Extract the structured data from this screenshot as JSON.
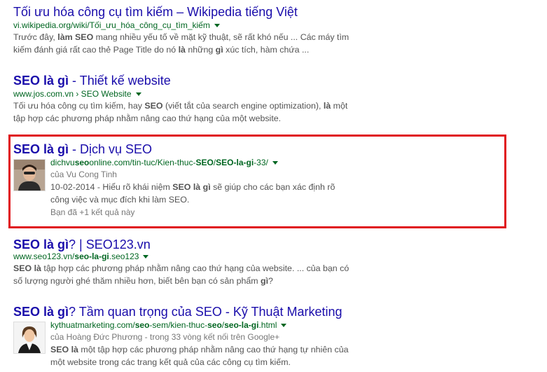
{
  "results": [
    {
      "title": "Tối ưu hóa công cụ tìm kiếm – Wikipedia tiếng Việt",
      "url": "vi.wikipedia.org/wiki/Tối_ưu_hóa_công_cụ_tìm_kiếm",
      "snippet_lines": [
        [
          {
            "t": "Trước đây, ",
            "b": false
          },
          {
            "t": "làm SEO",
            "b": true
          },
          {
            "t": " mang nhiều yếu tố về mặt kỹ thuật, sẽ rất khó nếu ... Các máy tìm",
            "b": false
          }
        ],
        [
          {
            "t": "kiếm đánh giá rất cao thẻ Page Title do nó ",
            "b": false
          },
          {
            "t": "là",
            "b": true
          },
          {
            "t": " những ",
            "b": false
          },
          {
            "t": "gì",
            "b": true
          },
          {
            "t": " xúc tích, hàm chứa ...",
            "b": false
          }
        ]
      ]
    },
    {
      "title_parts": [
        {
          "t": "SEO là gì",
          "b": true
        },
        {
          "t": " - Thiết kế website",
          "b": false
        }
      ],
      "url_parts": [
        {
          "t": "www.jos.com.vn › SEO Website",
          "b": false
        }
      ],
      "snippet_lines": [
        [
          {
            "t": "Tối ưu hóa công cụ tìm kiếm, hay ",
            "b": false
          },
          {
            "t": "SEO",
            "b": true
          },
          {
            "t": " (viết tắt của search engine optimization), ",
            "b": false
          },
          {
            "t": "là",
            "b": true
          },
          {
            "t": " một",
            "b": false
          }
        ],
        [
          {
            "t": "tập hợp các phương pháp nhằm nâng cao thứ hạng của một website.",
            "b": false
          }
        ]
      ]
    },
    {
      "title_parts": [
        {
          "t": "SEO là gì",
          "b": true
        },
        {
          "t": " - Dịch vụ SEO",
          "b": false
        }
      ],
      "url_parts": [
        {
          "t": "dichvu",
          "b": false
        },
        {
          "t": "seo",
          "b": true
        },
        {
          "t": "online.com/tin-tuc/Kien-thuc-",
          "b": false
        },
        {
          "t": "SEO",
          "b": true
        },
        {
          "t": "/",
          "b": false
        },
        {
          "t": "SEO-la-gi",
          "b": true
        },
        {
          "t": "-33/",
          "b": false
        }
      ],
      "author": "của Vu Cong Tinh",
      "snippet_lines": [
        [
          {
            "t": "10-02-2014 - Hiểu rõ khái niệm ",
            "b": false
          },
          {
            "t": "SEO là gì",
            "b": true
          },
          {
            "t": " sẽ giúp cho các bạn xác định rõ",
            "b": false
          }
        ],
        [
          {
            "t": "công việc và mục đích khi làm SEO.",
            "b": false
          }
        ]
      ],
      "plus_one": "Bạn đã +1 kết quả này"
    },
    {
      "title_parts": [
        {
          "t": "SEO là gì",
          "b": true
        },
        {
          "t": "? | SEO123.vn",
          "b": false
        }
      ],
      "url_parts": [
        {
          "t": "www.seo123.vn/",
          "b": false
        },
        {
          "t": "seo-la-gi",
          "b": true
        },
        {
          "t": ".seo123",
          "b": false
        }
      ],
      "snippet_lines": [
        [
          {
            "t": "SEO là",
            "b": true
          },
          {
            "t": " tập hợp các phương pháp nhằm nâng cao thứ hạng của website. ... của bạn có",
            "b": false
          }
        ],
        [
          {
            "t": "số lượng người ghé thăm nhiều hơn, biết bên bạn có sản phẩm ",
            "b": false
          },
          {
            "t": "gì",
            "b": true
          },
          {
            "t": "?",
            "b": false
          }
        ]
      ]
    },
    {
      "title_parts": [
        {
          "t": "SEO là gì",
          "b": true
        },
        {
          "t": "? Tầm quan trọng của SEO - Kỹ Thuật Marketing",
          "b": false
        }
      ],
      "url_parts": [
        {
          "t": "kythuatmarketing.com/",
          "b": false
        },
        {
          "t": "seo",
          "b": true
        },
        {
          "t": "-sem/kien-thuc-",
          "b": false
        },
        {
          "t": "seo",
          "b": true
        },
        {
          "t": "/",
          "b": false
        },
        {
          "t": "seo-la-gi",
          "b": true
        },
        {
          "t": ".html",
          "b": false
        }
      ],
      "author": "của Hoàng Đức Phương - trong 33 vòng kết nối trên Google+",
      "snippet_lines": [
        [
          {
            "t": "SEO là",
            "b": true
          },
          {
            "t": " một tập hợp các phương pháp nhằm nâng cao thứ hạng tự nhiên của",
            "b": false
          }
        ],
        [
          {
            "t": "một website trong các trang kết quả của các công cụ tìm kiếm.",
            "b": false
          }
        ]
      ]
    }
  ],
  "colors": {
    "title": "#1a0dab",
    "url": "#006621",
    "snippet": "#545454",
    "highlight": "#e0141b"
  }
}
